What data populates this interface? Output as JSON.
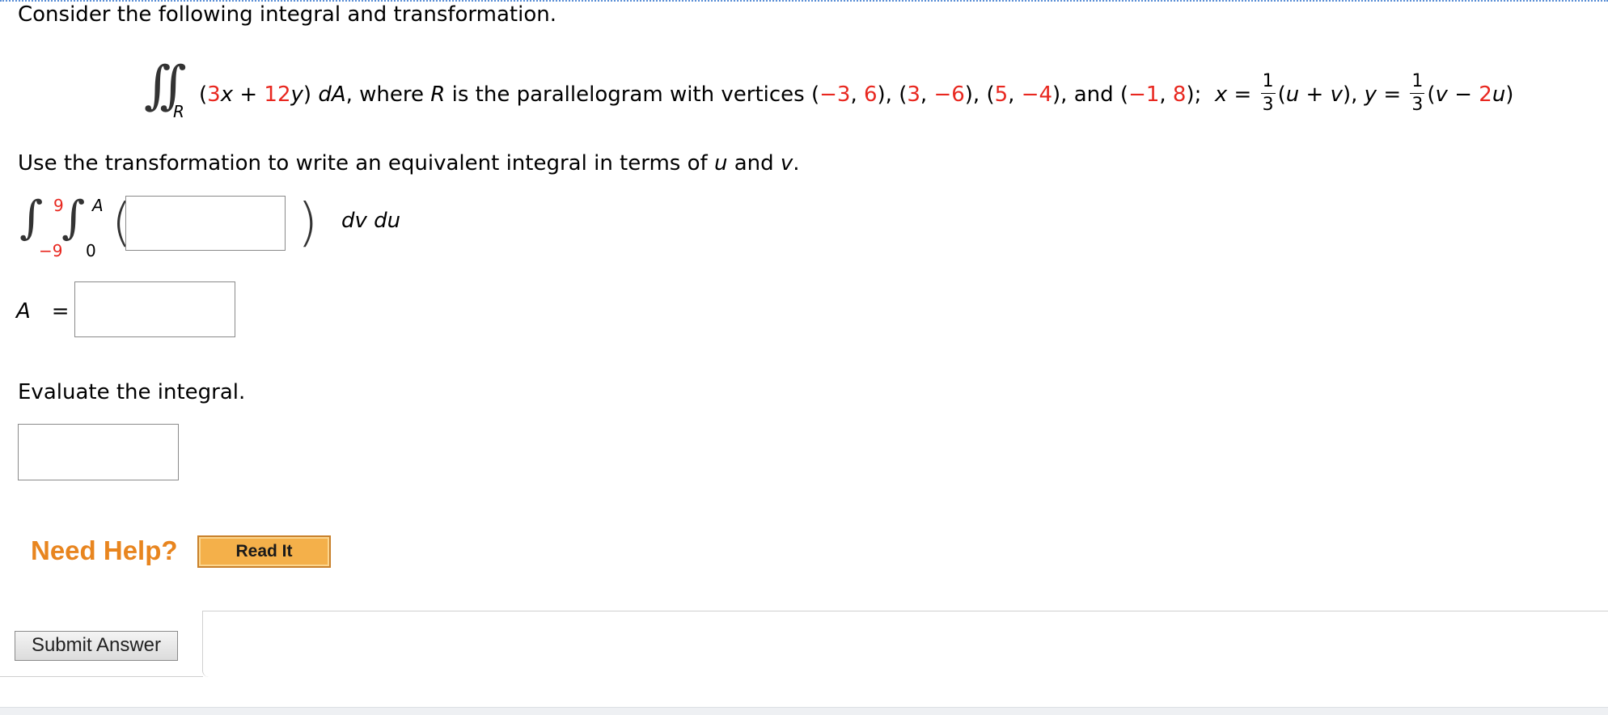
{
  "intro": "Consider the following integral and transformation.",
  "given": {
    "integral_symbol": "∫∫",
    "region_sub": "R",
    "open_paren": "(",
    "coef_x": "3",
    "var_x": "x",
    "plus": " + ",
    "coef_y": "12",
    "var_y": "y",
    "close_paren": ")",
    "dA": "dA",
    "where_text": ", where ",
    "R": "R",
    "parallelogram_text": " is the parallelogram with vertices ",
    "vertices": [
      {
        "a": "−3",
        "b": "6"
      },
      {
        "a": "3",
        "b": "−6"
      },
      {
        "a": "5",
        "b": "−4"
      },
      {
        "a": "−1",
        "b": "8"
      }
    ],
    "and_text": "and ",
    "x_var": "x",
    "y_var": "y",
    "eq": " = ",
    "frac_num": "1",
    "frac_den": "3",
    "u": "u",
    "v": "v",
    "x_expr_plus": " + ",
    "y_expr_minus": " − ",
    "coef_2": "2"
  },
  "instruction": {
    "prefix": "Use the transformation to write an equivalent integral in terms of ",
    "u": "u",
    "and": " and ",
    "v": "v",
    "suffix": "."
  },
  "uv_integral": {
    "outer_upper": "9",
    "outer_lower": "−9",
    "inner_upper": "A",
    "inner_lower": "0",
    "integrand_value": "",
    "differentials": "dv du"
  },
  "a_field": {
    "label": "A",
    "equals": "=",
    "value": ""
  },
  "evaluate": {
    "label": "Evaluate the integral.",
    "value": ""
  },
  "help": {
    "need_help": "Need Help?",
    "read_it": "Read It"
  },
  "submit": {
    "label": "Submit Answer"
  },
  "colors": {
    "highlight_red": "#e8271f",
    "need_help_orange": "#e8851f",
    "read_it_bg": "#f4b04a",
    "top_border_blue": "#5b8fd6"
  }
}
